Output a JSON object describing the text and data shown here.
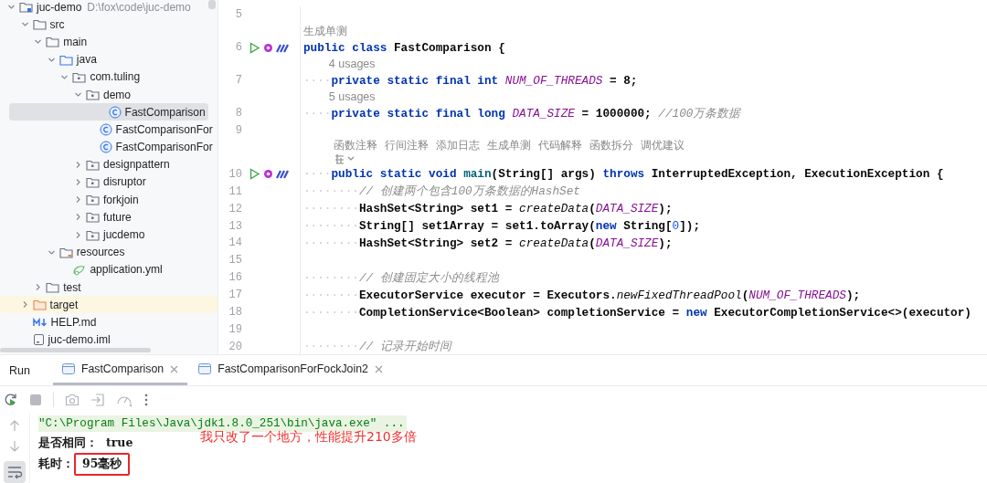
{
  "sidebar": {
    "tree": [
      {
        "label": "juc-demo",
        "path": "D:\\fox\\code\\juc-demo",
        "kind": "module",
        "expanded": true,
        "selected": false,
        "highlighted": false,
        "children": [
          {
            "label": "src",
            "kind": "folder",
            "expanded": true,
            "selected": false,
            "highlighted": false,
            "children": [
              {
                "label": "main",
                "kind": "folder",
                "expanded": true,
                "selected": false,
                "highlighted": false,
                "children": [
                  {
                    "label": "java",
                    "kind": "source-root",
                    "expanded": true,
                    "selected": false,
                    "highlighted": false,
                    "children": [
                      {
                        "label": "com.tuling",
                        "kind": "package",
                        "expanded": true,
                        "selected": false,
                        "highlighted": false,
                        "children": [
                          {
                            "label": "demo",
                            "kind": "package",
                            "expanded": true,
                            "selected": false,
                            "highlighted": false,
                            "children": [
                              {
                                "label": "FastComparison",
                                "kind": "class",
                                "selected": true,
                                "highlighted": false
                              },
                              {
                                "label": "FastComparisonFor",
                                "kind": "class",
                                "selected": false,
                                "highlighted": false
                              },
                              {
                                "label": "FastComparisonFor",
                                "kind": "class",
                                "selected": false,
                                "highlighted": false
                              }
                            ]
                          },
                          {
                            "label": "designpattern",
                            "kind": "package",
                            "expanded": false,
                            "selected": false,
                            "highlighted": false
                          },
                          {
                            "label": "disruptor",
                            "kind": "package",
                            "expanded": false,
                            "selected": false,
                            "highlighted": false
                          },
                          {
                            "label": "forkjoin",
                            "kind": "package",
                            "expanded": false,
                            "selected": false,
                            "highlighted": false
                          },
                          {
                            "label": "future",
                            "kind": "package",
                            "expanded": false,
                            "selected": false,
                            "highlighted": false
                          },
                          {
                            "label": "jucdemo",
                            "kind": "package",
                            "expanded": false,
                            "selected": false,
                            "highlighted": false
                          }
                        ]
                      }
                    ]
                  },
                  {
                    "label": "resources",
                    "kind": "resources",
                    "expanded": true,
                    "selected": false,
                    "highlighted": false,
                    "children": [
                      {
                        "label": "application.yml",
                        "kind": "yml",
                        "selected": false,
                        "highlighted": false
                      }
                    ]
                  }
                ]
              },
              {
                "label": "test",
                "kind": "folder",
                "expanded": false,
                "selected": false,
                "highlighted": false
              }
            ]
          },
          {
            "label": "target",
            "kind": "excluded-folder",
            "expanded": false,
            "selected": false,
            "highlighted": true
          },
          {
            "label": "HELP.md",
            "kind": "markdown",
            "selected": false,
            "highlighted": false
          },
          {
            "label": "juc-demo.iml",
            "kind": "file",
            "selected": false,
            "highlighted": false
          }
        ]
      }
    ]
  },
  "editor": {
    "lines": [
      {
        "kind": "code",
        "number": "5"
      },
      {
        "kind": "hint",
        "text": "生成单测"
      },
      {
        "kind": "code",
        "number": "6",
        "gutter_icons": true,
        "tokens": [
          {
            "kind": "keyword",
            "text": "public class "
          },
          {
            "kind": "plain",
            "text": "FastComparison {"
          }
        ]
      },
      {
        "kind": "usages",
        "text": "4 usages"
      },
      {
        "kind": "code",
        "number": "7",
        "tokens": [
          {
            "kind": "whitespace",
            "text": "····"
          },
          {
            "kind": "keyword",
            "text": "private static final int "
          },
          {
            "kind": "constant",
            "text": "NUM_OF_THREADS"
          },
          {
            "kind": "plain",
            "text": " = 8;"
          }
        ]
      },
      {
        "kind": "usages",
        "text": "5 usages"
      },
      {
        "kind": "code",
        "number": "8",
        "tokens": [
          {
            "kind": "whitespace",
            "text": "····"
          },
          {
            "kind": "keyword",
            "text": "private static final long "
          },
          {
            "kind": "constant",
            "text": "DATA_SIZE"
          },
          {
            "kind": "plain",
            "text": " = 1000000; "
          },
          {
            "kind": "comment",
            "text": "//100万条数据"
          }
        ]
      },
      {
        "kind": "code",
        "number": "9"
      },
      {
        "kind": "actions",
        "items": [
          "函数注释",
          "行间注释",
          "添加日志",
          "生成单测",
          "代码解释",
          "函数拆分",
          "调优建议"
        ]
      },
      {
        "kind": "more"
      },
      {
        "kind": "code",
        "number": "10",
        "gutter_icons": true,
        "tokens": [
          {
            "kind": "whitespace",
            "text": "····"
          },
          {
            "kind": "keyword",
            "text": "public static void "
          },
          {
            "kind": "method",
            "text": "main"
          },
          {
            "kind": "plain",
            "text": "(String[] args) "
          },
          {
            "kind": "keyword",
            "text": "throws"
          },
          {
            "kind": "plain",
            "text": " InterruptedException, ExecutionException {"
          }
        ]
      },
      {
        "kind": "code",
        "number": "11",
        "tokens": [
          {
            "kind": "whitespace",
            "text": "········"
          },
          {
            "kind": "comment",
            "text": "// 创建两个包含100万条数据的HashSet"
          }
        ]
      },
      {
        "kind": "code",
        "number": "12",
        "tokens": [
          {
            "kind": "whitespace",
            "text": "········"
          },
          {
            "kind": "plain",
            "text": "HashSet<String> set1 = "
          },
          {
            "kind": "static",
            "text": "createData"
          },
          {
            "kind": "plain",
            "text": "("
          },
          {
            "kind": "constant",
            "text": "DATA_SIZE"
          },
          {
            "kind": "plain",
            "text": ");"
          }
        ]
      },
      {
        "kind": "code",
        "number": "13",
        "tokens": [
          {
            "kind": "whitespace",
            "text": "········"
          },
          {
            "kind": "plain",
            "text": "String[] set1Array = set1.toArray("
          },
          {
            "kind": "keyword",
            "text": "new"
          },
          {
            "kind": "plain",
            "text": " String["
          },
          {
            "kind": "number",
            "text": "0"
          },
          {
            "kind": "plain",
            "text": "]);"
          }
        ]
      },
      {
        "kind": "code",
        "number": "14",
        "tokens": [
          {
            "kind": "whitespace",
            "text": "········"
          },
          {
            "kind": "plain",
            "text": "HashSet<String> set2 = "
          },
          {
            "kind": "static",
            "text": "createData"
          },
          {
            "kind": "plain",
            "text": "("
          },
          {
            "kind": "constant",
            "text": "DATA_SIZE"
          },
          {
            "kind": "plain",
            "text": ");"
          }
        ]
      },
      {
        "kind": "code",
        "number": "15"
      },
      {
        "kind": "code",
        "number": "16",
        "tokens": [
          {
            "kind": "whitespace",
            "text": "········"
          },
          {
            "kind": "comment",
            "text": "// 创建固定大小的线程池"
          }
        ]
      },
      {
        "kind": "code",
        "number": "17",
        "tokens": [
          {
            "kind": "whitespace",
            "text": "········"
          },
          {
            "kind": "plain",
            "text": "ExecutorService executor = Executors."
          },
          {
            "kind": "static",
            "text": "newFixedThreadPool"
          },
          {
            "kind": "plain",
            "text": "("
          },
          {
            "kind": "constant",
            "text": "NUM_OF_THREADS"
          },
          {
            "kind": "plain",
            "text": ");"
          }
        ]
      },
      {
        "kind": "code",
        "number": "18",
        "tokens": [
          {
            "kind": "whitespace",
            "text": "········"
          },
          {
            "kind": "plain",
            "text": "CompletionService<Boolean> completionService = "
          },
          {
            "kind": "keyword",
            "text": "new"
          },
          {
            "kind": "plain",
            "text": " ExecutorCompletionService<>(executor)"
          }
        ]
      },
      {
        "kind": "code",
        "number": "19"
      },
      {
        "kind": "code",
        "number": "20",
        "tokens": [
          {
            "kind": "whitespace",
            "text": "········"
          },
          {
            "kind": "comment",
            "text": "// 记录开始时间"
          }
        ]
      }
    ]
  },
  "run_panel": {
    "title": "Run",
    "tabs": [
      {
        "label": "FastComparison",
        "selected": true
      },
      {
        "label": "FastComparisonForFockJoin2",
        "selected": false
      }
    ],
    "console": {
      "lines": [
        {
          "kind": "command",
          "text": "\"C:\\Program Files\\Java\\jdk1.8.0_251\\bin\\java.exe\" ..."
        },
        {
          "kind": "output",
          "label": "是否相同：",
          "value": "true",
          "boxed": false
        },
        {
          "kind": "output",
          "label": "耗时：",
          "value": "95毫秒",
          "boxed": true
        }
      ]
    },
    "annotation": {
      "text": "我只改了一个地方，性能提升210多倍"
    }
  }
}
